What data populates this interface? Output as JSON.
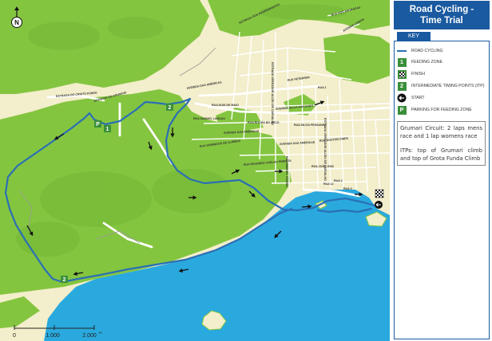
{
  "header": {
    "title_line1": "Road Cycling -",
    "title_line2": "Time Trial"
  },
  "key": {
    "tab_label": "KEY",
    "items": [
      {
        "symbol": "line",
        "label": "ROAD CYCLING"
      },
      {
        "symbol": "1",
        "label": "FEEDING ZONE"
      },
      {
        "symbol": "checkered-flag",
        "label": "FINISH"
      },
      {
        "symbol": "2",
        "label": "INTERMEDIATE TIMING POINTS (ITP)"
      },
      {
        "symbol": "arrow-left",
        "label": "START"
      },
      {
        "symbol": "P",
        "label": "PARKING FOR FEEDING ZONE"
      }
    ]
  },
  "info": {
    "circuit": "Grumari Circuit: 2 laps mens race and 1 lap womens race",
    "itps": "ITPs: top of Grumari climb and top of Grota Funda Climb"
  },
  "map": {
    "compass": "N",
    "marker_labels": {
      "itp": "2",
      "feeding": "1",
      "parking": "P"
    },
    "street_labels": [
      "ESTRADA DO CRISTO FUNDO",
      "ESTRADA DO GRUMARI",
      "AVENIDA DAS AMÉRICAS",
      "RUA DOIS DE MAIO",
      "AVENIDA DAS AMÉRICAS",
      "RUA SAMUEL LANDAU",
      "RUA DOMINGOS DE ALMEIDA",
      "ESTRADA VEREADOR ALCEU DE CARVALHO",
      "AVENIDA GILKA MACHADO",
      "RUA PETERSEN",
      "RUA SILVIA PESSANHA",
      "RUA ROCHA NO ARCO",
      "AVENIDA DAS AMÉRICAS",
      "RUA EDUARDO COELHO PIMENTA",
      "RUA MANUEL CÍCERO",
      "RUA JOÃO XXIII",
      "RUA 1",
      "RUA 2",
      "RUA 3",
      "RUA 12",
      "RUA DOUTOR CIRES",
      "AVENIDA LISBOA",
      "RUA DOS ANDRADAS",
      "ESTRADA DOS BANDEIRANTES",
      "ESTRADA VEREADOR ALCEU DE CARVALHO"
    ]
  },
  "scale": {
    "labels": [
      "0",
      "1.000",
      "2.000"
    ],
    "unit": "m"
  },
  "colors": {
    "sea": "#2aa9de",
    "hills": "#84c540",
    "lowland": "#f3eecb",
    "route": "#2b6fb4",
    "title_bg": "#1a5aa0",
    "marker_green": "#3a8f3a"
  }
}
